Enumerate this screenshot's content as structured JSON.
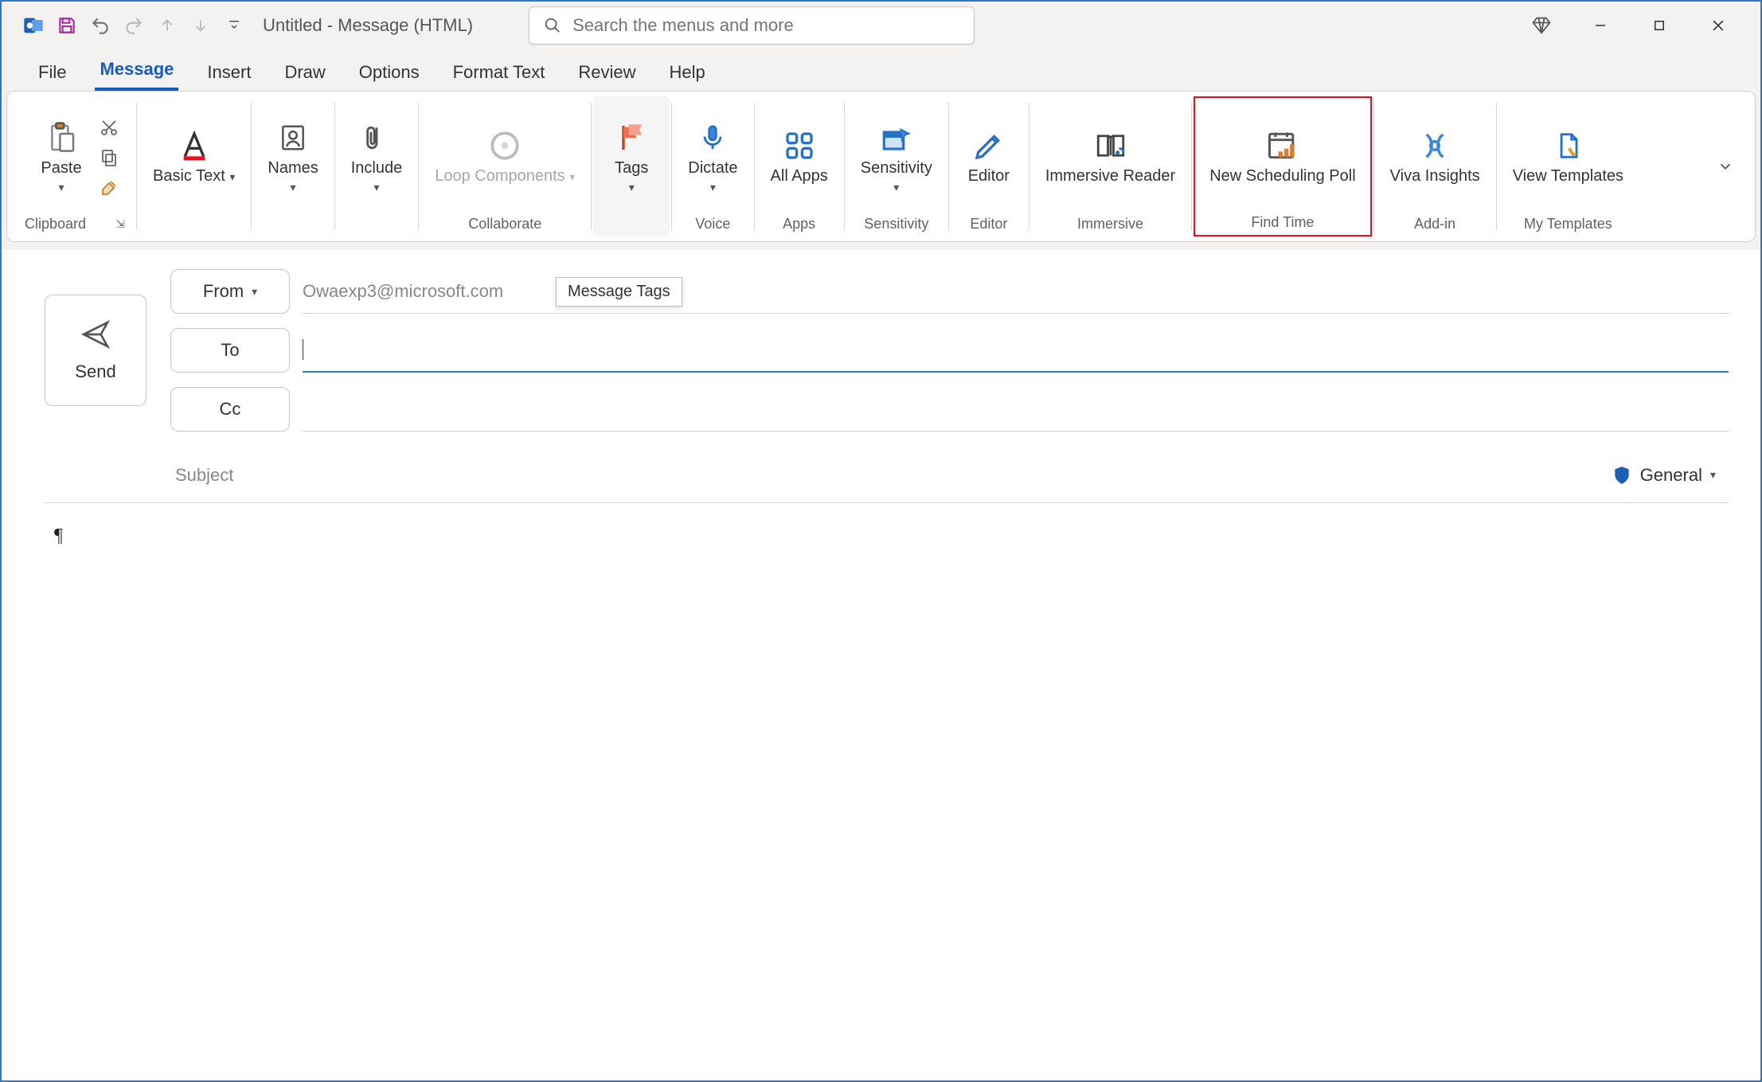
{
  "titlebar": {
    "title": "Untitled  -  Message (HTML)",
    "search_placeholder": "Search the menus and more"
  },
  "tabs": {
    "file": "File",
    "message": "Message",
    "insert": "Insert",
    "draw": "Draw",
    "options": "Options",
    "format_text": "Format Text",
    "review": "Review",
    "help": "Help"
  },
  "ribbon": {
    "clipboard": {
      "paste": "Paste",
      "group": "Clipboard"
    },
    "basic_text": "Basic Text",
    "names": "Names",
    "include": "Include",
    "loop": "Loop Components",
    "collaborate": "Collaborate",
    "tags": "Tags",
    "tags_tooltip": "Message Tags",
    "dictate": "Dictate",
    "voice": "Voice",
    "all_apps": "All Apps",
    "apps": "Apps",
    "sensitivity": "Sensitivity",
    "sensitivity_group": "Sensitivity",
    "editor": "Editor",
    "editor_group": "Editor",
    "immersive_reader": "Immersive Reader",
    "immersive_group": "Immersive",
    "new_poll": "New Scheduling Poll",
    "find_time": "Find Time",
    "viva": "Viva Insights",
    "addin": "Add-in",
    "view_templates": "View Templates",
    "my_templates": "My Templates"
  },
  "compose": {
    "send": "Send",
    "from": "From",
    "from_value": "Owaexp3@microsoft.com",
    "to": "To",
    "cc": "Cc",
    "subject": "Subject",
    "sensitivity_badge": "General",
    "body": "¶"
  }
}
